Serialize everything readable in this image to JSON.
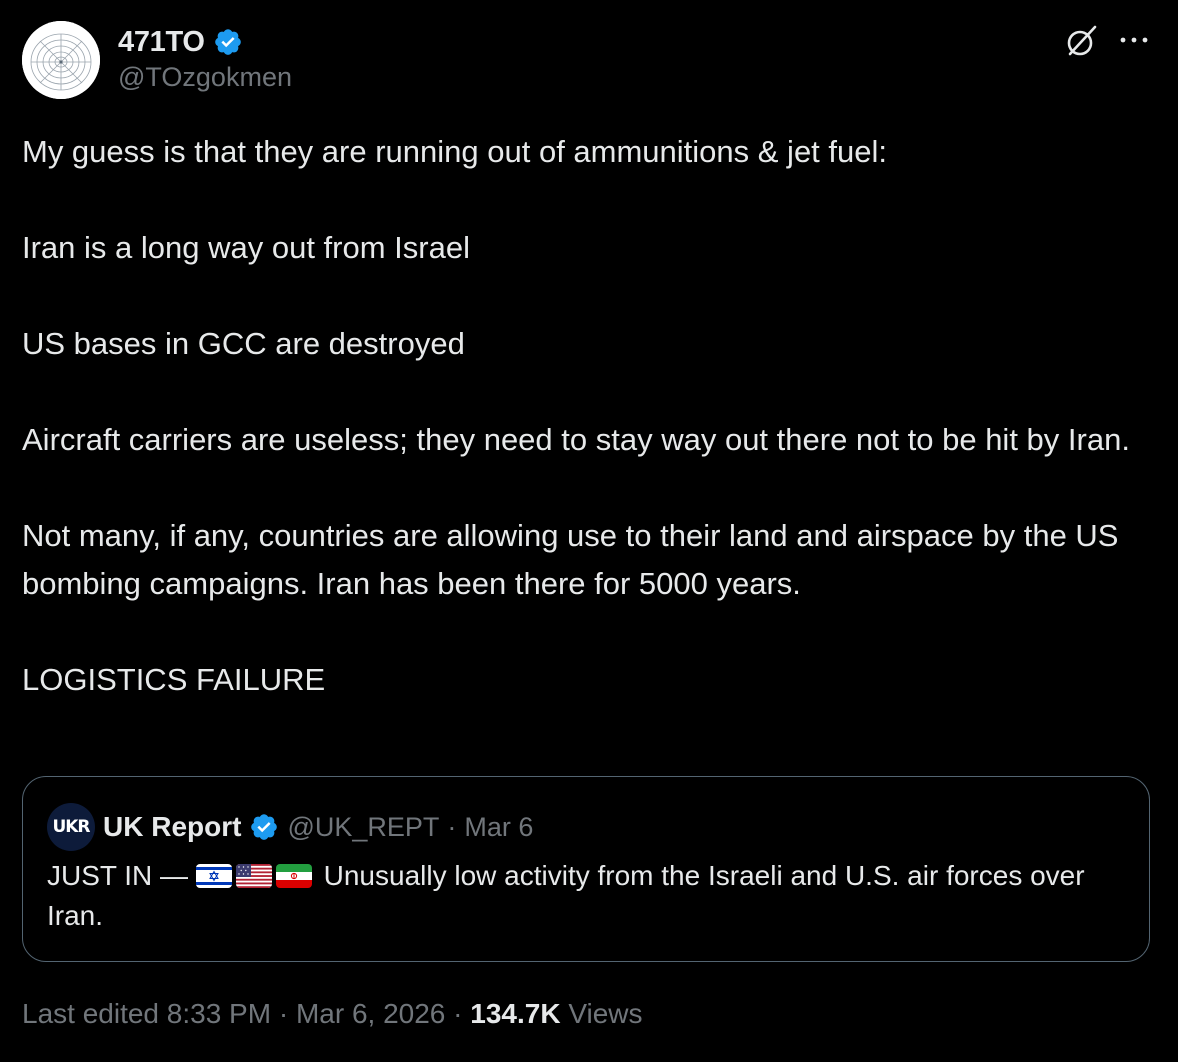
{
  "author": {
    "display_name": "471TO",
    "handle": "@TOzgokmen",
    "verified_icon": "verified-badge-icon",
    "verified_color": "#1d9bf0"
  },
  "header_actions": {
    "grok_icon": "grok-icon",
    "more_icon": "more-options-icon"
  },
  "tweet": {
    "paragraphs": [
      "My guess is that they are running out of ammunitions & jet fuel:",
      "Iran is a long way out from Israel",
      "US bases in GCC are destroyed",
      "Aircraft carriers are useless; they need to stay way out there not to be hit by Iran.",
      "Not many, if any, countries are allowing use to their land and airspace by the US bombing campaigns. Iran has been there for 5000 years.",
      "LOGISTICS FAILURE"
    ]
  },
  "quote": {
    "avatar_text": "UKR",
    "display_name": "UK Report",
    "handle": "@UK_REPT",
    "separator": "·",
    "date": "Mar 6",
    "text_prefix": "JUST IN —",
    "flags": [
      "israel-flag-icon",
      "us-flag-icon",
      "iran-flag-icon"
    ],
    "text_suffix": "Unusually low activity from the Israeli and U.S. air forces over Iran."
  },
  "meta": {
    "edited_label": "Last edited 8:33 PM",
    "sep1": " · ",
    "date": "Mar 6, 2026",
    "sep2": " · ",
    "views_count": "134.7K",
    "views_label": "Views"
  },
  "colors": {
    "background": "#000000",
    "text": "#e7e9ea",
    "secondary": "#71767b",
    "border": "#536471",
    "accent": "#1d9bf0"
  }
}
